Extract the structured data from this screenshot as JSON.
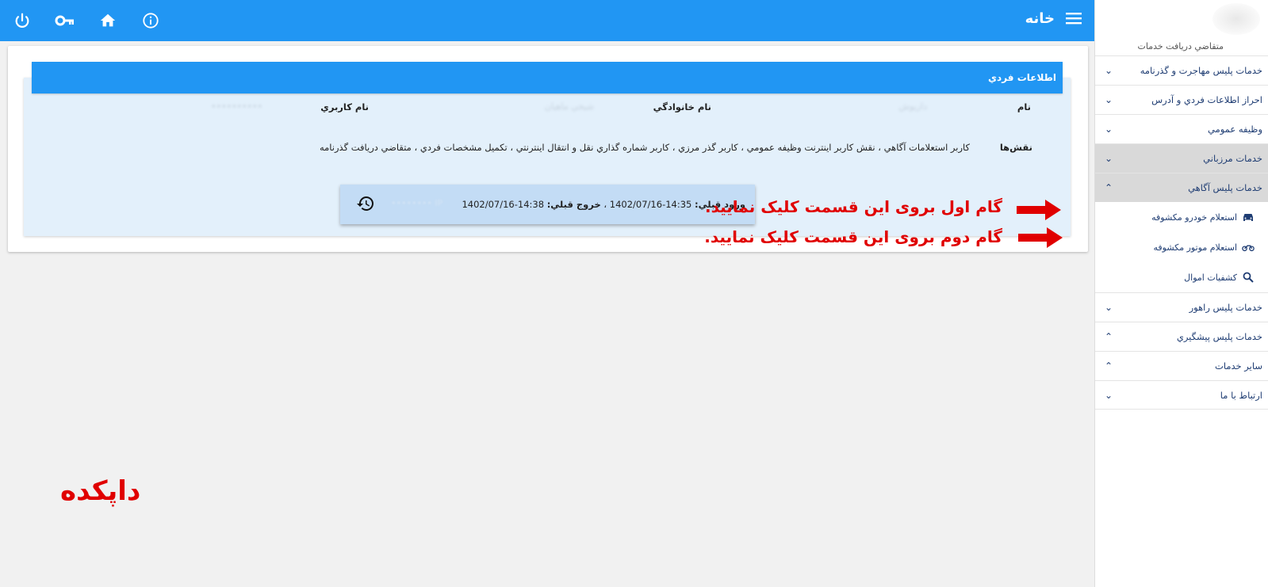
{
  "header": {
    "title": "خانه",
    "icons": [
      "power-icon",
      "key-icon",
      "home-icon",
      "info-icon",
      "menu-icon"
    ]
  },
  "sidebar": {
    "user_role": "متقاضي دريافت خدمات",
    "items": [
      {
        "label": "خدمات پليس مهاجرت و گذرنامه",
        "chevron": "down"
      },
      {
        "label": "احراز اطلاعات فردي و آدرس",
        "chevron": "down"
      },
      {
        "label": "وظيفه عمومي",
        "chevron": "down"
      },
      {
        "label": "خدمات مرزباني",
        "chevron": "down"
      },
      {
        "label": "خدمات پليس آگاهي",
        "chevron": "up"
      },
      {
        "label": "خدمات پليس راهور",
        "chevron": "down"
      },
      {
        "label": "خدمات پليس پيشگيري",
        "chevron": "up"
      },
      {
        "label": "ساير خدمات",
        "chevron": "up"
      },
      {
        "label": "ارتباط با ما",
        "chevron": "down"
      }
    ],
    "subitems": [
      {
        "label": "استعلام خودرو مكشوفه",
        "icon": "car-icon"
      },
      {
        "label": "استعلام موتور مكشوفه",
        "icon": "motorcycle-icon"
      },
      {
        "label": "كشفيات اموال",
        "icon": "search-icon"
      }
    ]
  },
  "panel": {
    "title": "اطلاعات فردي",
    "name_label": "نام",
    "family_label": "نام خانوادگي",
    "username_label": "نام كاربري",
    "roles_label": "نقش‌ها",
    "roles_value": "كاربر استعلامات آگاهي ، نقش كاربر اينترنت وظيفه عمومي ، كاربر گذر مرزي ، كاربر شماره گذاري نقل و انتقال اينترنتي ، تكميل مشخصات فردي ، متقاضي دريافت گذرنامه",
    "name_value": "داريوش",
    "family_value": "شيخي ماهيان",
    "username_value": "••••••••••"
  },
  "login": {
    "prev_login_label": "ورود قبلي:",
    "prev_login_value": "1402/07/16-14:35",
    "separator": "،",
    "prev_logout_label": "خروج قبلي:",
    "prev_logout_value": "1402/07/16-14:38",
    "ip_value": "IP ••••••••"
  },
  "annotations": {
    "step1": "گام اول بروی این قسمت کلیک نمایید.",
    "step2": "گام دوم بروی این قسمت کلیک نمایید.",
    "watermark": "داپکده"
  },
  "colors": {
    "primary": "#2196f3",
    "panel_bg": "#e3f0fb",
    "annotation": "#e00000",
    "menu_text": "#1f3d73"
  }
}
